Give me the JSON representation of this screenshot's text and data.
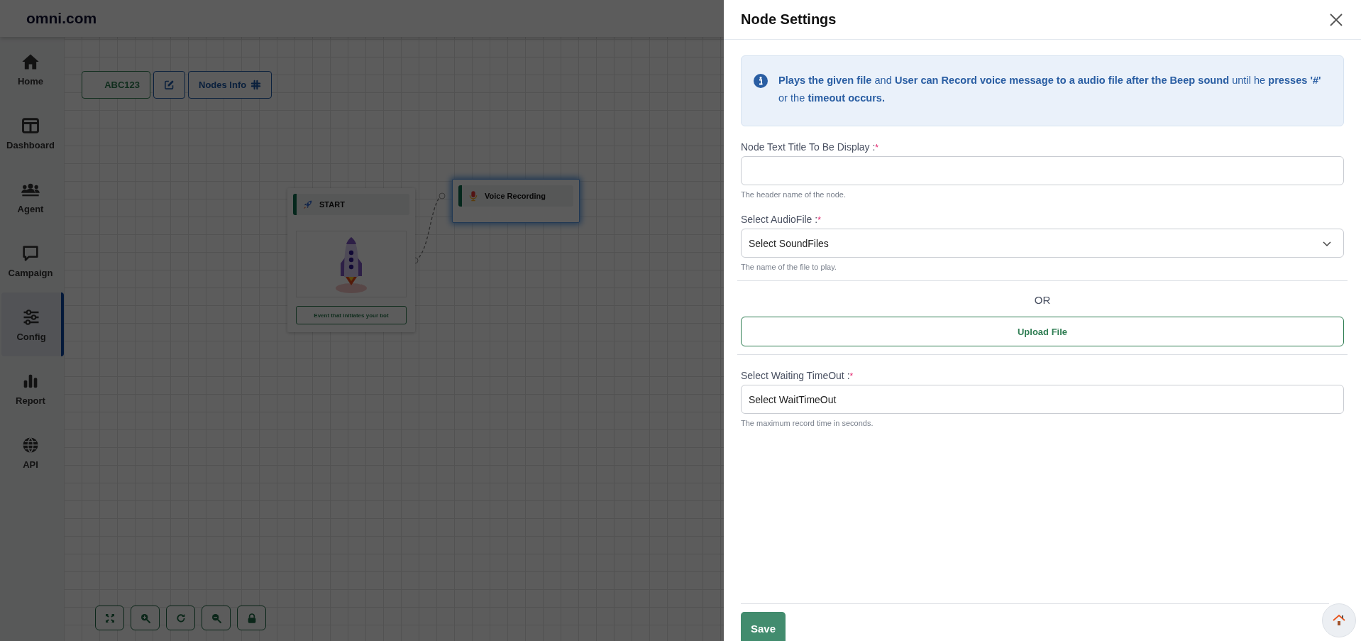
{
  "app": {
    "brand": "omni.com"
  },
  "sidebar": {
    "items": [
      {
        "label": "Home",
        "selected": false
      },
      {
        "label": "Dashboard",
        "selected": false
      },
      {
        "label": "Agent",
        "selected": false
      },
      {
        "label": "Campaign",
        "selected": false
      },
      {
        "label": "Config",
        "selected": true
      },
      {
        "label": "Report",
        "selected": false
      },
      {
        "label": "API",
        "selected": false
      }
    ]
  },
  "toolbar": {
    "flow_name": "ABC123",
    "nodes_info": "Nodes Info"
  },
  "canvas": {
    "nodes": [
      {
        "kind": "start",
        "title": "START",
        "caption": "Event that initiates your bot",
        "selected": false
      },
      {
        "kind": "voice",
        "title": "Voice Recording",
        "selected": true
      }
    ]
  },
  "panel": {
    "title": "Node Settings",
    "info": "**Plays the given file** and **User can Record voice message to a audio file after the Beep sound** until he **presses '#'** or the **timeout occurs.**",
    "sections": [
      {
        "kind": "text_field",
        "label": "Node Text Title To Be Display :",
        "required_mark": "*",
        "hint": "The header name of the node."
      },
      {
        "kind": "select_field",
        "label": "Select AudioFile :",
        "required_mark": "*",
        "value": "Select SoundFiles",
        "hint": "The name of the file to play."
      },
      {
        "kind": "divider_text",
        "text": "OR"
      },
      {
        "kind": "upload",
        "label": "Upload File"
      },
      {
        "kind": "text_field",
        "label": "Select Waiting TimeOut :",
        "required_mark": "*",
        "value": "Select WaitTimeOut",
        "hint": "The maximum record time in seconds."
      }
    ],
    "save": "Save"
  }
}
